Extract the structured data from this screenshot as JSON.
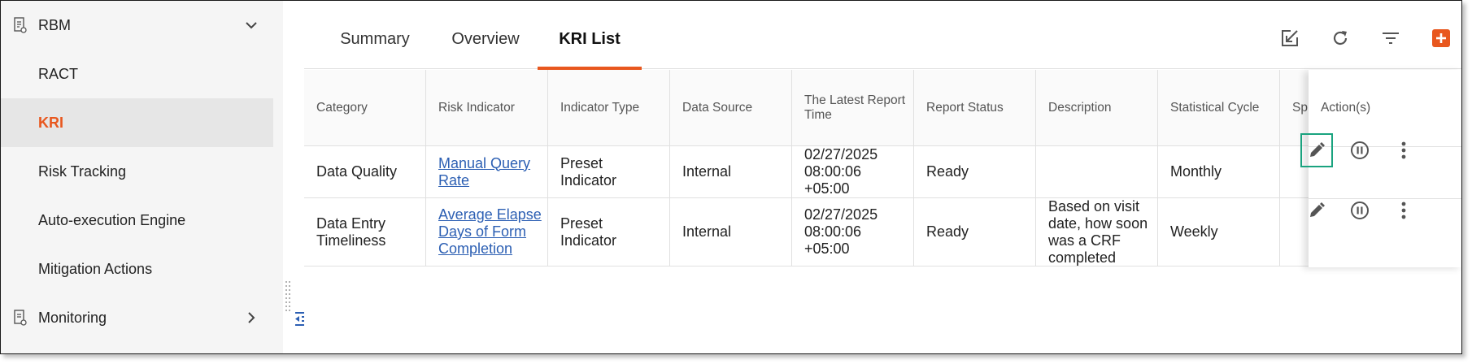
{
  "sidebar": {
    "group_rbm": "RBM",
    "items": [
      "RACT",
      "KRI",
      "Risk Tracking",
      "Auto-execution Engine",
      "Mitigation Actions"
    ],
    "group_monitoring": "Monitoring"
  },
  "tabs": [
    "Summary",
    "Overview",
    "KRI List"
  ],
  "accent_color": "#e8571e",
  "table": {
    "headers": {
      "category": "Category",
      "risk_indicator": "Risk Indicator",
      "indicator_type": "Indicator Type",
      "data_source": "Data Source",
      "latest_report_time_1": "The Latest Report",
      "latest_report_time_2": "Time",
      "report_status": "Report Status",
      "description": "Description",
      "statistical_cycle": "Statistical Cycle",
      "sp_truncated": "Sp",
      "actions": "Action(s)"
    },
    "rows": [
      {
        "category": [
          "Data Quality"
        ],
        "risk_indicator": [
          "Manual Query",
          "Rate"
        ],
        "indicator_type": [
          "Preset",
          "Indicator"
        ],
        "data_source": "Internal",
        "latest_report_time": [
          "02/27/2025",
          "08:00:06",
          "+05:00"
        ],
        "report_status": "Ready",
        "description": [],
        "statistical_cycle": "Monthly"
      },
      {
        "category": [
          "Data Entry",
          "Timeliness"
        ],
        "risk_indicator": [
          "Average Elapse",
          "Days of Form",
          "Completion"
        ],
        "indicator_type": [
          "Preset",
          "Indicator"
        ],
        "data_source": "Internal",
        "latest_report_time": [
          "02/27/2025",
          "08:00:06",
          "+05:00"
        ],
        "report_status": "Ready",
        "description": [
          "Based on visit",
          "date, how soon",
          "was a CRF",
          "completed"
        ],
        "statistical_cycle": "Weekly"
      }
    ]
  },
  "icons": {
    "toolbar": [
      "export-icon",
      "refresh-icon",
      "filter-icon",
      "add-icon"
    ],
    "row_actions": [
      "edit-icon",
      "pause-icon",
      "more-vertical-icon"
    ]
  }
}
